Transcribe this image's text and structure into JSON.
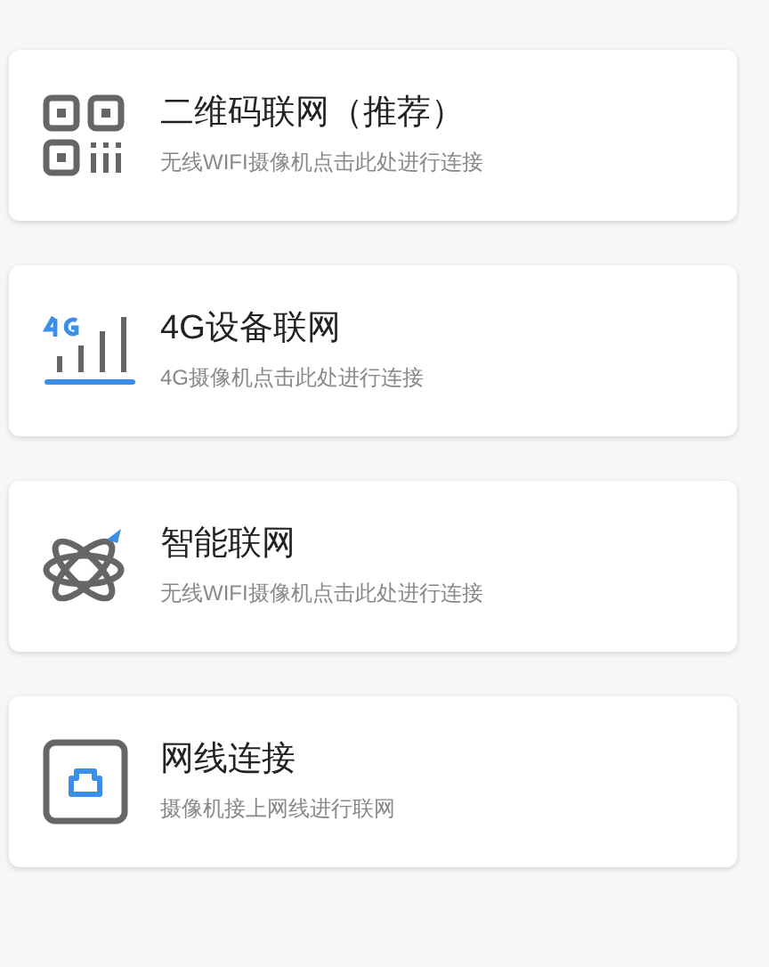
{
  "options": [
    {
      "kind": "qr",
      "title": "二维码联网（推荐）",
      "subtitle": "无线WIFI摄像机点击此处进行连接"
    },
    {
      "kind": "cellular",
      "title": "4G设备联网",
      "subtitle": "4G摄像机点击此处进行连接"
    },
    {
      "kind": "smart",
      "title": "智能联网",
      "subtitle": "无线WIFI摄像机点击此处进行连接"
    },
    {
      "kind": "cable",
      "title": "网线连接",
      "subtitle": "摄像机接上网线进行联网"
    }
  ]
}
